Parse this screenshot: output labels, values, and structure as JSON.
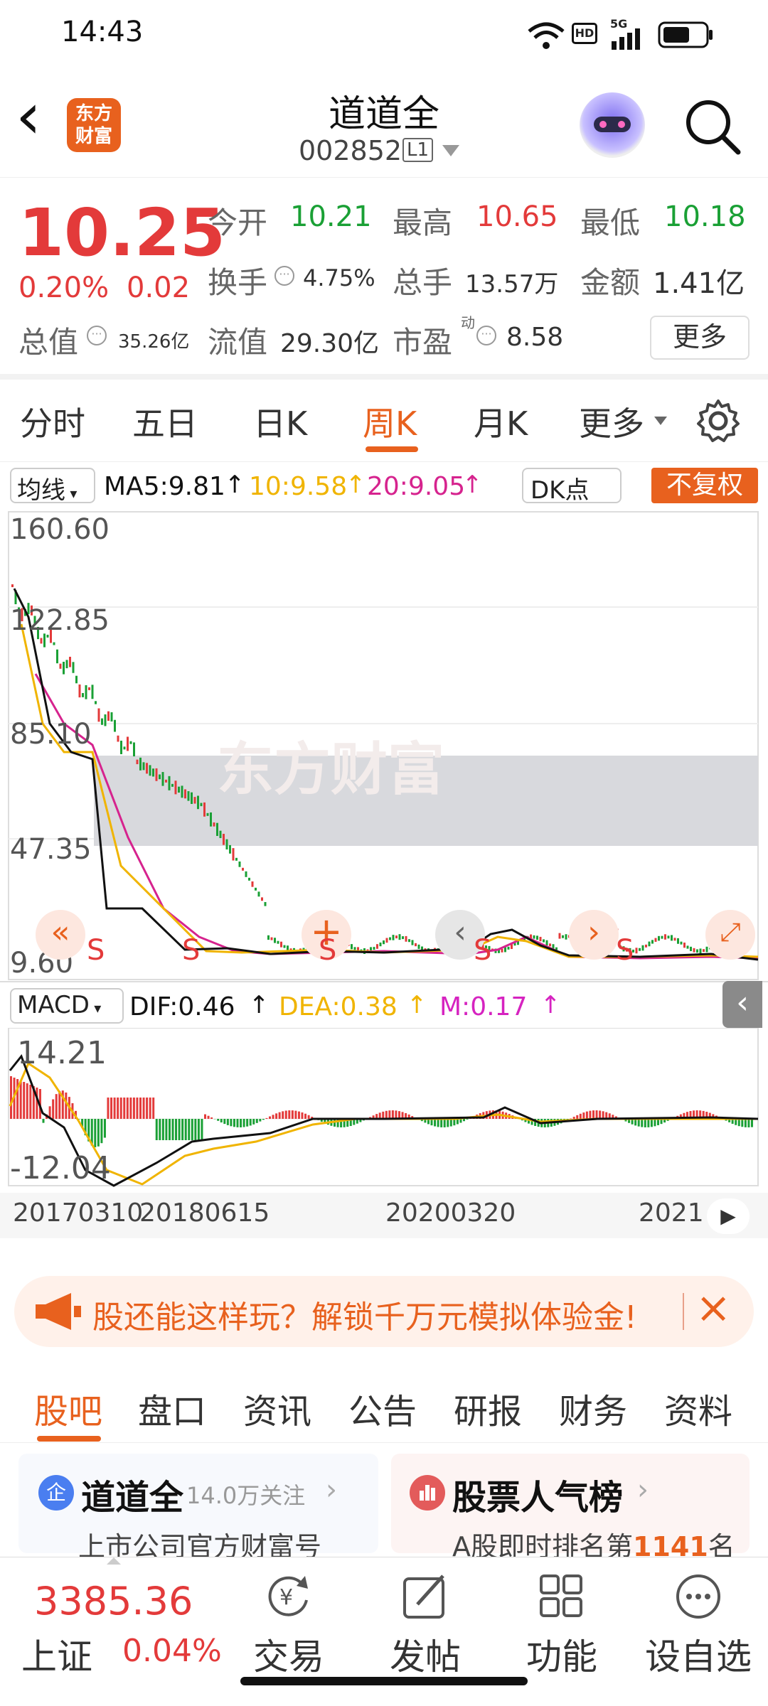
{
  "status_bar": {
    "time": "14:43",
    "hd": "HD",
    "net": "5G"
  },
  "header": {
    "back": "‹",
    "logo_line1": "东方",
    "logo_line2": "财富",
    "stock_name": "道道全",
    "stock_code": "002852",
    "level_badge": "L1"
  },
  "quote": {
    "price": "10.25",
    "change_pct": "0.20%",
    "change_amt": "0.02",
    "open_label": "今开",
    "open": "10.21",
    "high_label": "最高",
    "high": "10.65",
    "low_label": "最低",
    "low": "10.18",
    "turnover_label": "换手",
    "turnover": "4.75%",
    "volume_label": "总手",
    "volume": "13.57万",
    "amount_label": "金额",
    "amount": "1.41亿",
    "mktcap_label": "总值",
    "mktcap": "35.26亿",
    "float_label": "流值",
    "float": "29.30亿",
    "pe_label": "市盈",
    "pe_sup": "动",
    "pe": "8.58",
    "more": "更多"
  },
  "tabs": [
    "分时",
    "五日",
    "日K",
    "周K",
    "月K",
    "更多"
  ],
  "active_tab": "周K",
  "ma_bar": {
    "selector": "均线",
    "ma5": "MA5:9.81",
    "ma10": "10:9.58",
    "ma20": "20:9.05",
    "dk": "DK点",
    "restore": "不复权"
  },
  "price_axis": [
    "160.60",
    "122.85",
    "85.10",
    "47.35",
    "9.60"
  ],
  "macd_bar": {
    "selector": "MACD",
    "dif": "DIF:0.46",
    "dea": "DEA:0.38",
    "m": "M:0.17"
  },
  "macd_axis": [
    "14.21",
    "-12.04"
  ],
  "date_axis": [
    "20170310",
    "20180615",
    "20200320",
    "2021"
  ],
  "sell_marks": [
    "S",
    "S",
    "S",
    "S",
    "S"
  ],
  "banner": {
    "text": "股还能这样玩？解锁千万元模拟体验金!"
  },
  "subtabs": [
    "股吧",
    "盘口",
    "资讯",
    "公告",
    "研报",
    "财务",
    "资料"
  ],
  "active_subtab": "股吧",
  "card_left": {
    "badge": "企",
    "title": "道道全",
    "follow": "14.0万关注",
    "sub": "上市公司官方财富号"
  },
  "card_right": {
    "title": "股票人气榜",
    "sub_prefix": "A股即时排名第",
    "rank": "1141",
    "sub_suffix": "名"
  },
  "bottom": {
    "index_value": "3385.36",
    "index_name": "上证",
    "index_change": "0.04%",
    "items": [
      "交易",
      "发帖",
      "功能",
      "设自选"
    ]
  },
  "colors": {
    "up": "#e33a3a",
    "down": "#1aa035",
    "accent": "#e8611e",
    "ma5": "#111111",
    "ma10": "#f0b400",
    "ma20": "#d6238e"
  }
}
